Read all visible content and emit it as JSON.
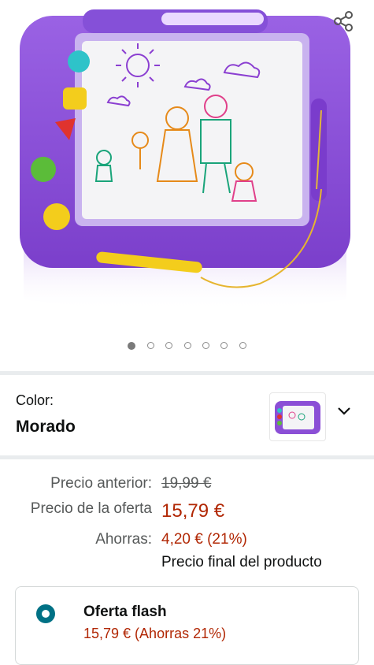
{
  "gallery": {
    "share_icon": "share-icon",
    "image_alt": "magnetic-drawing-board",
    "dot_count": 7,
    "active_index": 0
  },
  "variant": {
    "label": "Color:",
    "value": "Morado",
    "dropdown_icon": "chevron-down-icon"
  },
  "pricing": {
    "previous_label": "Precio anterior:",
    "previous_value": "19,99 €",
    "offer_label": "Precio de la oferta",
    "offer_value": "15,79 €",
    "savings_label": "Ahorras:",
    "savings_value": "4,20 € (21%)",
    "final_note": "Precio final del producto"
  },
  "offer_option": {
    "title": "Oferta flash",
    "subtitle": "15,79 € (Ahorras 21%)",
    "selected": true
  },
  "colors": {
    "product_purple": "#8b4fd6",
    "link_teal": "#007185",
    "price_red": "#b12704"
  }
}
